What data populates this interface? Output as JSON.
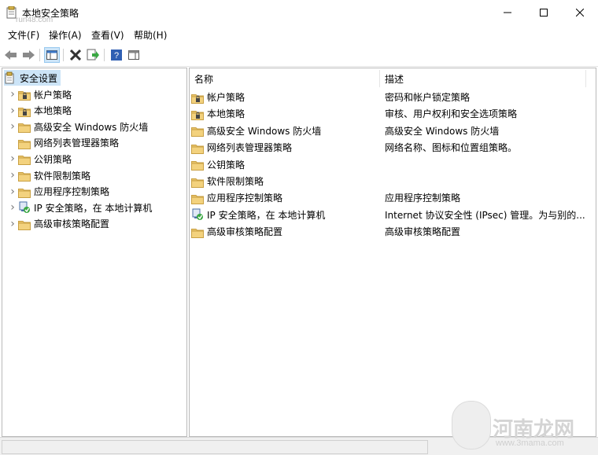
{
  "window": {
    "title": "本地安全策略"
  },
  "watermark_top": "run48.com",
  "menu": [
    "文件(F)",
    "操作(A)",
    "查看(V)",
    "帮助(H)"
  ],
  "tree": {
    "root": "安全设置",
    "items": [
      {
        "label": "帐户策略",
        "expandable": true,
        "icon": "folder-lock-icon"
      },
      {
        "label": "本地策略",
        "expandable": true,
        "icon": "folder-lock-icon"
      },
      {
        "label": "高级安全 Windows 防火墙",
        "expandable": true,
        "icon": "folder-icon"
      },
      {
        "label": "网络列表管理器策略",
        "expandable": false,
        "icon": "folder-icon"
      },
      {
        "label": "公钥策略",
        "expandable": true,
        "icon": "folder-icon"
      },
      {
        "label": "软件限制策略",
        "expandable": true,
        "icon": "folder-icon"
      },
      {
        "label": "应用程序控制策略",
        "expandable": true,
        "icon": "folder-icon"
      },
      {
        "label": "IP 安全策略，在 本地计算机",
        "expandable": true,
        "icon": "ipsec-icon"
      },
      {
        "label": "高级审核策略配置",
        "expandable": true,
        "icon": "folder-icon"
      }
    ]
  },
  "list": {
    "columns": [
      "名称",
      "描述"
    ],
    "rows": [
      {
        "name": "帐户策略",
        "desc": "密码和帐户锁定策略",
        "icon": "folder-lock-icon"
      },
      {
        "name": "本地策略",
        "desc": "审核、用户权利和安全选项策略",
        "icon": "folder-lock-icon"
      },
      {
        "name": "高级安全 Windows 防火墙",
        "desc": "高级安全 Windows 防火墙",
        "icon": "folder-icon"
      },
      {
        "name": "网络列表管理器策略",
        "desc": "网络名称、图标和位置组策略。",
        "icon": "folder-icon"
      },
      {
        "name": "公钥策略",
        "desc": "",
        "icon": "folder-icon"
      },
      {
        "name": "软件限制策略",
        "desc": "",
        "icon": "folder-icon"
      },
      {
        "name": "应用程序控制策略",
        "desc": "应用程序控制策略",
        "icon": "folder-icon"
      },
      {
        "name": "IP 安全策略，在 本地计算机",
        "desc": "Internet 协议安全性 (IPsec) 管理。为与别的...",
        "icon": "ipsec-icon"
      },
      {
        "name": "高级审核策略配置",
        "desc": "高级审核策略配置",
        "icon": "folder-icon"
      }
    ]
  },
  "watermark": {
    "brand": "河南龙网",
    "url": "www.3mama.com"
  },
  "colors": {
    "selection": "#cce4f7",
    "folder": "#e8c36a",
    "folder_dark": "#c9a043"
  }
}
